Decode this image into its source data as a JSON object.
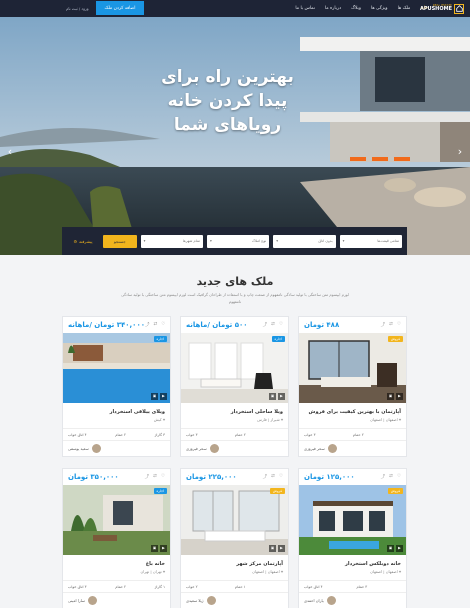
{
  "colors": {
    "accent": "#1a96e4",
    "brand": "#f2b51d",
    "dark": "#1e2436"
  },
  "header": {
    "logo_small": "REAL ESTATE",
    "logo_big": "APUSHOME",
    "menu": [
      "خانه",
      "ملک ها",
      "ویژگی ها",
      "وبلاگ",
      "درباره ما",
      "تماس با ما"
    ],
    "add_button": "اضافه کردن ملک",
    "login": "ورود / ثبت نام"
  },
  "hero": {
    "headline": [
      "بهترین راه برای",
      "پیدا کردن خانه",
      "رویاهای شما"
    ]
  },
  "search": {
    "fields": [
      "تمامی قیمت‌ها",
      "بدون اتاق",
      "نوع املاک",
      "تمام شهرها"
    ],
    "button": "جستجو",
    "advanced": "پیشرفته"
  },
  "section": {
    "title": "ملک های جدید",
    "subtitle": "لورم ایپسوم متن ساختگی با تولید سادگی نامفهوم از صنعت چاپ و با استفاده از طراحان گرافیک است لورم ایپسوم متن ساختگی با تولید سادگی نامفهوم"
  },
  "cards": [
    {
      "price": "۴۸۸ تومان",
      "badge": "فروش",
      "title": "آپارتمان با بهترین کیفیت برای فروش",
      "addr": "اصفهان | اصفهان",
      "f1": "۳ خواب",
      "f2": "۲ حمام",
      "f3": "",
      "agent": "سحر فیروزی",
      "time": "",
      "scene": "living"
    },
    {
      "price": "۵۰۰ تومان /ماهانه",
      "badge": "اجاره",
      "title": "ویلا ساحلی استخردار",
      "addr": "شیراز | فارس",
      "f1": "۳ خواب",
      "f2": "۲ حمام",
      "f3": "",
      "agent": "سحر فیروزی",
      "time": "",
      "scene": "white"
    },
    {
      "price": "۳۴۰,۰۰۰ تومان /ماهانه",
      "badge": "اجاره",
      "title": "ویلای ییلاقی استخردار",
      "addr": "کیش",
      "f1": "۴ اتاق خواب",
      "f2": "۲ حمام",
      "f3": "۳ گاراژ",
      "agent": "سعید یوسفی",
      "time": "",
      "scene": "pool"
    },
    {
      "price": "۱۲۵,۰۰۰ تومان",
      "badge": "فروش",
      "title": "خانه دوبلکس استخردار",
      "addr": "اصفهان | اصفهان",
      "f1": "۴ اتاق خواب",
      "f2": "۳ حمام",
      "f3": "",
      "agent": "یاران احمدی",
      "time": "",
      "scene": "villa"
    },
    {
      "price": "۲۲۵,۰۰۰ تومان",
      "badge": "فروش",
      "title": "آپارتمان مرکز شهر",
      "addr": "اصفهان | اصفهان",
      "f1": "۲ خواب",
      "f2": "۱ حمام",
      "f3": "",
      "agent": "ژیلا سعیدی",
      "time": "",
      "scene": "white2"
    },
    {
      "price": "۳۵۰,۰۰۰ تومان",
      "badge": "اجاره",
      "title": "خانه باغ",
      "addr": "تهران | تهران",
      "f1": "۳ اتاق خواب",
      "f2": "۲ حمام",
      "f3": "۱ گاراژ",
      "agent": "سارا امینی",
      "time": "",
      "scene": "garden"
    }
  ]
}
